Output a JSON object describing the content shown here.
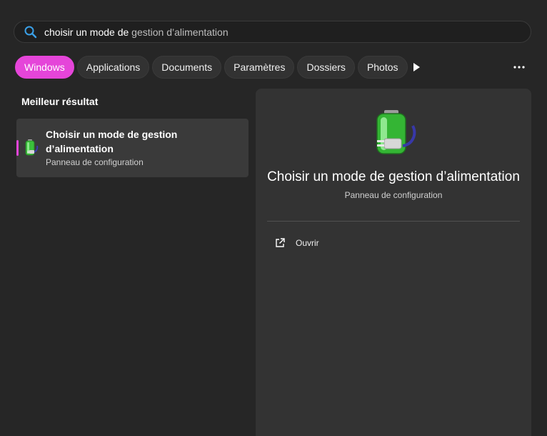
{
  "search": {
    "query_typed": "choisir un mode de",
    "query_suggestion": " gestion d’alimentation",
    "icon": "search-icon"
  },
  "tabs": [
    {
      "label": "Windows",
      "active": true
    },
    {
      "label": "Applications",
      "active": false
    },
    {
      "label": "Documents",
      "active": false
    },
    {
      "label": "Paramètres",
      "active": false
    },
    {
      "label": "Dossiers",
      "active": false
    },
    {
      "label": "Photos",
      "active": false
    }
  ],
  "section": {
    "title": "Meilleur résultat"
  },
  "best_result": {
    "title": "Choisir un mode de gestion d’alimentation",
    "subtitle": "Panneau de configuration",
    "icon": "power-battery-icon"
  },
  "detail": {
    "title": "Choisir un mode de gestion d’alimentation",
    "subtitle": "Panneau de configuration",
    "action_open": "Ouvrir"
  },
  "colors": {
    "accent": "#e545d9",
    "background": "#262626",
    "panel": "#333333"
  }
}
